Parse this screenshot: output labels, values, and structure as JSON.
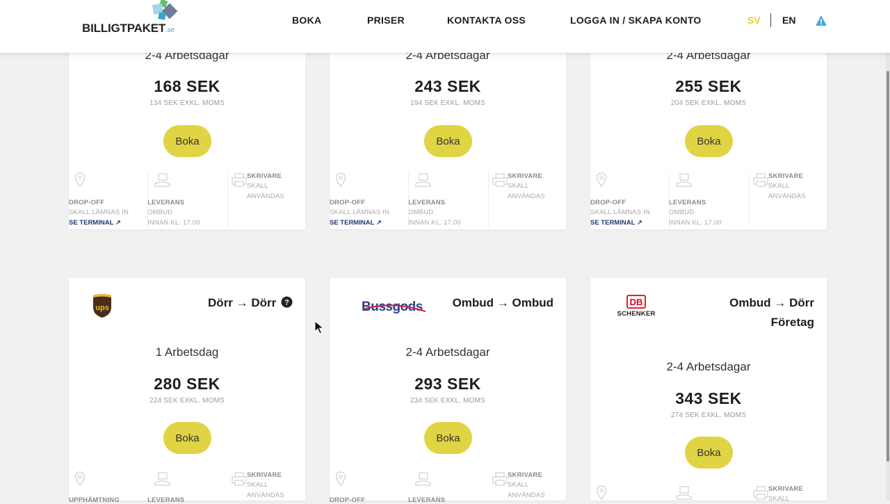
{
  "header": {
    "logo_text": "BILLIGTPAKET",
    "logo_suffix": ".se",
    "nav": [
      "BOKA",
      "PRISER",
      "KONTAKTA OSS",
      "LOGGA IN / SKAPA KONTO"
    ],
    "lang_sv": "SV",
    "lang_en": "EN"
  },
  "colors": {
    "accent_yellow": "#e1d444",
    "lang_active": "#e1cf3e",
    "link_blue": "#1e3a6e",
    "background": "#f1f1f1"
  },
  "top_cards": [
    {
      "days": "2-4 Arbetsdagar",
      "price": "168 SEK",
      "exkl": "134 SEK EXKL. MOMS",
      "button": "Boka",
      "features": {
        "dropoff_title": "DROP-OFF",
        "dropoff_line": "SKALL LÄMNAS IN",
        "dropoff_link": "SE TERMINAL",
        "leverans_title": "LEVERANS",
        "leverans_line1": "OMBUD",
        "leverans_line2": "INNAN KL. 17.00",
        "skrivare_title": "SKRIVARE",
        "skrivare_line1": "SKALL",
        "skrivare_line2": "ANVÄNDAS"
      }
    },
    {
      "days": "2-4 Arbetsdagar",
      "price": "243 SEK",
      "exkl": "194 SEK EXKL. MOMS",
      "button": "Boka",
      "features": {
        "dropoff_title": "DROP-OFF",
        "dropoff_line": "SKALL LÄMNAS IN",
        "dropoff_link": "SE TERMINAL",
        "leverans_title": "LEVERANS",
        "leverans_line1": "OMBUD",
        "leverans_line2": "INNAN KL. 17.00",
        "skrivare_title": "SKRIVARE",
        "skrivare_line1": "SKALL",
        "skrivare_line2": "ANVÄNDAS"
      }
    },
    {
      "days": "2-4 Arbetsdagar",
      "price": "255 SEK",
      "exkl": "204 SEK EXKL. MOMS",
      "button": "Boka",
      "features": {
        "dropoff_title": "DROP-OFF",
        "dropoff_line": "SKALL LÄMNAS IN",
        "dropoff_link": "SE TERMINAL",
        "leverans_title": "LEVERANS",
        "leverans_line1": "OMBUD",
        "leverans_line2": "INNAN KL. 17.00",
        "skrivare_title": "SKRIVARE",
        "skrivare_line1": "SKALL",
        "skrivare_line2": "ANVÄNDAS"
      }
    }
  ],
  "bottom_cards": [
    {
      "carrier": "ups",
      "route": "Dörr → Dörr",
      "days": "1 Arbetsdag",
      "price": "280 SEK",
      "exkl": "224 SEK EXKL. MOMS",
      "button": "Boka",
      "features": {
        "pickup_title": "UPPHÄMTNING",
        "leverans_title": "LEVERANS",
        "skrivare_title": "SKRIVARE",
        "skrivare_line1": "SKALL",
        "skrivare_line2": "ANVÄNDAS"
      }
    },
    {
      "carrier": "Bussgods",
      "route": "Ombud → Ombud",
      "days": "2-4 Arbetsdagar",
      "price": "293 SEK",
      "exkl": "234 SEK EXKL. MOMS",
      "button": "Boka",
      "features": {
        "dropoff_title": "DROP-OFF",
        "leverans_title": "LEVERANS",
        "skrivare_title": "SKRIVARE",
        "skrivare_line1": "SKALL",
        "skrivare_line2": "ANVÄNDAS"
      }
    },
    {
      "carrier": "DB",
      "carrier_sub": "SCHENKER",
      "route": "Ombud → Dörr",
      "route_sub": "Företag",
      "days": "2-4 Arbetsdagar",
      "price": "343 SEK",
      "exkl": "274 SEK EXKL. MOMS",
      "button": "Boka",
      "features": {
        "skrivare_title": "SKRIVARE",
        "skrivare_line1": "SKALL"
      }
    }
  ]
}
